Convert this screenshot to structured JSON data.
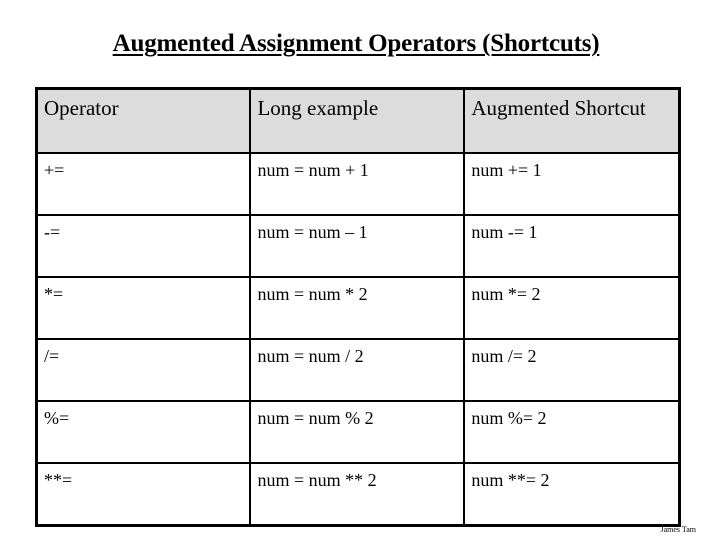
{
  "title": "Augmented Assignment Operators (Shortcuts)",
  "table": {
    "headers": [
      "Operator",
      "Long example",
      "Augmented Shortcut"
    ],
    "rows": [
      [
        "+=",
        "num = num + 1",
        "num += 1"
      ],
      [
        "-=",
        "num = num – 1",
        "num -= 1"
      ],
      [
        "*=",
        "num = num * 2",
        "num *= 2"
      ],
      [
        "/=",
        "num = num / 2",
        "num /= 2"
      ],
      [
        "%=",
        "num = num % 2",
        "num %= 2"
      ],
      [
        "**=",
        "num = num ** 2",
        "num **= 2"
      ]
    ]
  },
  "footer": "James Tam"
}
